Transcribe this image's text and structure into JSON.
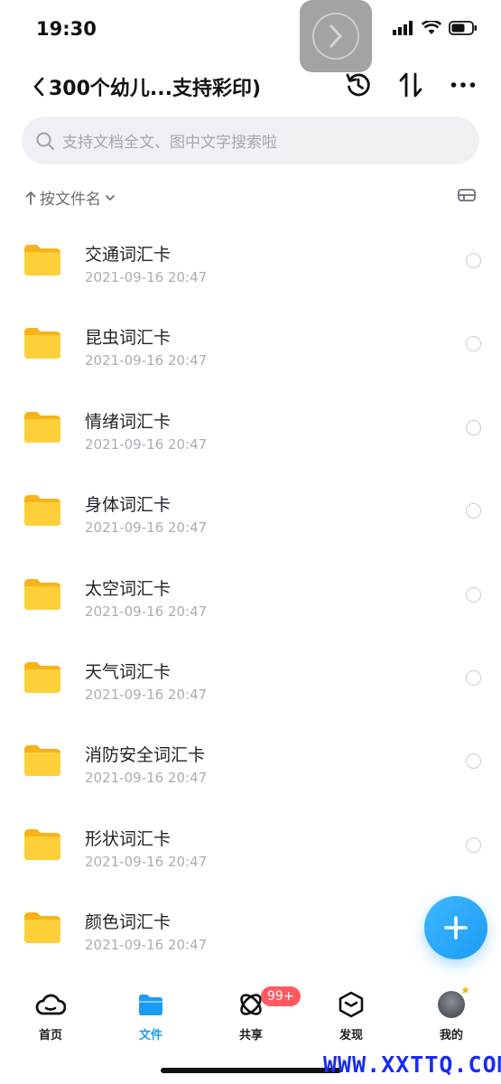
{
  "status": {
    "time": "19:30"
  },
  "nav": {
    "title": "300个幼儿...支持彩印)"
  },
  "search": {
    "placeholder": "支持文档全文、图中文字搜索啦"
  },
  "sort": {
    "label": "按文件名"
  },
  "files": [
    {
      "name": "交通词汇卡",
      "date": "2021-09-16 20:47"
    },
    {
      "name": "昆虫词汇卡",
      "date": "2021-09-16 20:47"
    },
    {
      "name": "情绪词汇卡",
      "date": "2021-09-16 20:47"
    },
    {
      "name": "身体词汇卡",
      "date": "2021-09-16 20:47"
    },
    {
      "name": "太空词汇卡",
      "date": "2021-09-16 20:47"
    },
    {
      "name": "天气词汇卡",
      "date": "2021-09-16 20:47"
    },
    {
      "name": "消防安全词汇卡",
      "date": "2021-09-16 20:47"
    },
    {
      "name": "形状词汇卡",
      "date": "2021-09-16 20:47"
    },
    {
      "name": "颜色词汇卡",
      "date": "2021-09-16 20:47"
    }
  ],
  "tabs": [
    {
      "label": "首页",
      "icon": "cloud-home-icon"
    },
    {
      "label": "文件",
      "icon": "folder-icon",
      "active": true
    },
    {
      "label": "共享",
      "icon": "share-orbit-icon",
      "badge": "99+"
    },
    {
      "label": "发现",
      "icon": "discover-cube-icon"
    },
    {
      "label": "我的",
      "icon": "avatar"
    }
  ],
  "watermark": "WWW.XXTTQ.COM",
  "colors": {
    "accent": "#1a9bf4",
    "folder": "#fcc62d",
    "badge": "#ff5a5f",
    "watermark": "#1a2cf0"
  }
}
